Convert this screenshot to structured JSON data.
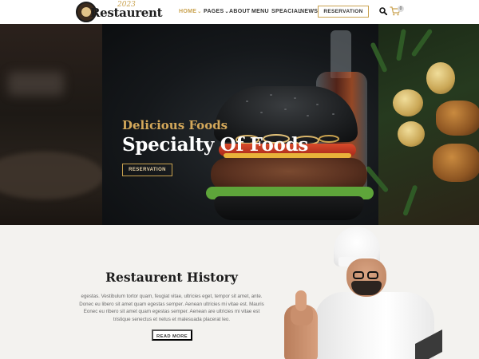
{
  "header": {
    "logo": {
      "name": "Restaurent",
      "script": "2023"
    },
    "nav": [
      {
        "label": "HOME",
        "caret": "⌄",
        "active": true
      },
      {
        "label": "PAGES",
        "caret": "⌄",
        "active": false
      },
      {
        "label": "ABOUT",
        "caret": "",
        "active": false
      },
      {
        "label": "MENU",
        "caret": "",
        "active": false
      },
      {
        "label": "SPEACIAL",
        "caret": "",
        "active": false
      },
      {
        "label": "NEWS",
        "caret": "",
        "active": false
      }
    ],
    "reservation_label": "RESERVATION",
    "cart_count": "0",
    "icons": {
      "search": "search-icon",
      "cart": "cart-icon"
    }
  },
  "hero": {
    "subtitle": "Delicious Foods",
    "title": "Specialty Of Foods",
    "button_label": "RESERVATION"
  },
  "history": {
    "title": "Restaurent History",
    "body_lines": [
      "egestas. Vestibulum tortor quam, feugiat vitae, ultricies eget, tempor sit amet, ante.",
      "Donec eu libero sit amet quam egestas semper. Aenean ultricies mi vitae est. Mauris",
      "Eonec eu ribero sit amet quam egestas semper. Aenean are ultricies mi vitae est",
      "tristique senectus et netus et malesuada placerat leo."
    ],
    "button_label": "READ MORE"
  },
  "colors": {
    "accent_gold": "#c9a24f",
    "hero_subtitle": "#d4a85a",
    "hero_bg": "#101214",
    "section_bg": "#f3f2ef"
  }
}
